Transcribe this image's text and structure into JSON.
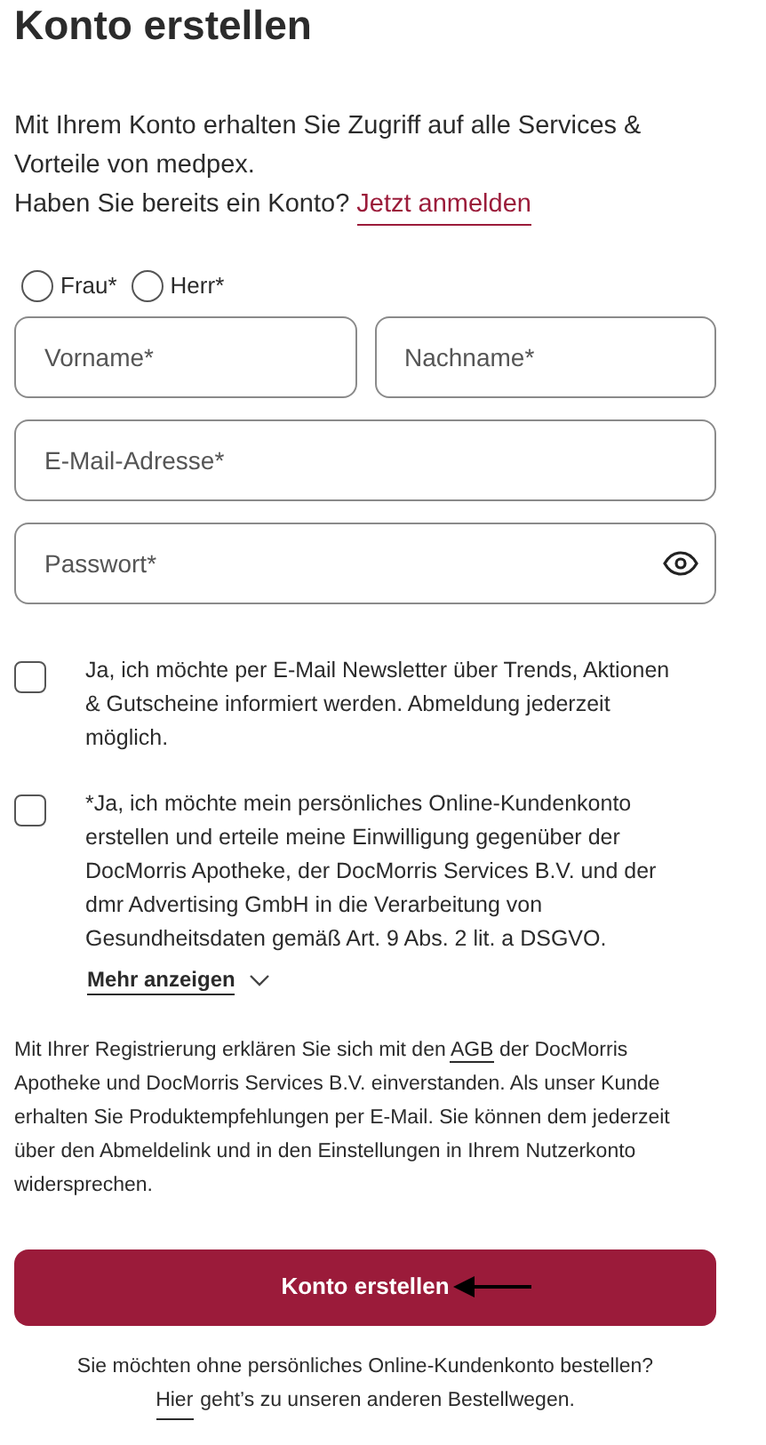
{
  "title": "Konto erstellen",
  "intro": {
    "text": "Mit Ihrem Konto erhalten Sie Zugriff auf alle Services & Vorteile von medpex.",
    "question": "Haben Sie bereits ein Konto?",
    "link": "Jetzt anmelden"
  },
  "salutation": [
    {
      "label": "Frau*",
      "selected": false
    },
    {
      "label": "Herr*",
      "selected": false
    }
  ],
  "fields": {
    "first_name": {
      "placeholder": "Vorname*"
    },
    "last_name": {
      "placeholder": "Nachname*"
    },
    "email": {
      "placeholder": "E-Mail-Adresse*"
    },
    "password": {
      "placeholder": "Passwort*"
    }
  },
  "consents": [
    {
      "text": "Ja, ich möchte per E-Mail Newsletter über Trends, Aktionen & Gutscheine informiert werden. Abmeldung jederzeit möglich.",
      "checked": false
    },
    {
      "text": "*Ja, ich möchte mein persönliches Online-Kundenkonto erstellen und erteile meine Einwilligung gegenüber der DocMorris Apotheke, der DocMorris Services B.V. und der dmr Advertising GmbH in die Verarbeitung von Gesundheitsdaten gemäß Art. 9 Abs. 2 lit. a DSGVO.",
      "checked": false
    }
  ],
  "show_more": "Mehr anzeigen",
  "terms": {
    "before": "Mit Ihrer Registrierung erklären Sie sich mit den",
    "link": "AGB",
    "after": "der DocMorris Apotheke und DocMorris Services B.V. einverstanden. Als unser Kunde erhalten Sie Produktempfehlungen per E-Mail. Sie können dem jederzeit über den Abmeldelink und in den Einstellungen in Ihrem Nutzerkonto widersprechen."
  },
  "submit": "Konto erstellen",
  "guest": {
    "question": "Sie möchten ohne persönliches Online-Kundenkonto bestellen?",
    "link": "Hier",
    "rest": "geht’s zu unseren anderen Bestellwegen."
  }
}
